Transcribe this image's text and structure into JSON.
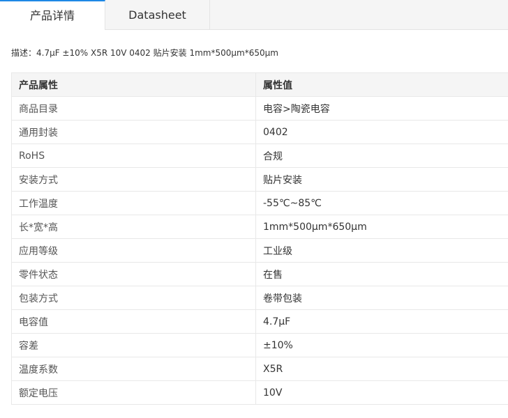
{
  "tabs": [
    {
      "label": "产品详情",
      "active": true
    },
    {
      "label": "Datasheet",
      "active": false
    }
  ],
  "description": "描述：4.7μF ±10% X5R 10V 0402 贴片安装 1mm*500μm*650μm",
  "table": {
    "headers": [
      "产品属性",
      "属性值"
    ],
    "rows": [
      {
        "name": "商品目录",
        "value": "电容>陶瓷电容"
      },
      {
        "name": "通用封装",
        "value": "0402"
      },
      {
        "name": "RoHS",
        "value": "合规"
      },
      {
        "name": "安装方式",
        "value": "贴片安装"
      },
      {
        "name": "工作温度",
        "value": "-55℃~85℃"
      },
      {
        "name": "长*宽*高",
        "value": "1mm*500μm*650μm"
      },
      {
        "name": "应用等级",
        "value": "工业级"
      },
      {
        "name": "零件状态",
        "value": "在售"
      },
      {
        "name": "包装方式",
        "value": "卷带包装"
      },
      {
        "name": "电容值",
        "value": "4.7μF"
      },
      {
        "name": "容差",
        "value": "±10%"
      },
      {
        "name": "温度系数",
        "value": "X5R"
      },
      {
        "name": "额定电压",
        "value": "10V"
      }
    ]
  },
  "colors": {
    "accent": "#1e88e5",
    "header_bg": "#f5f5f5",
    "border": "#e8e8e8"
  }
}
